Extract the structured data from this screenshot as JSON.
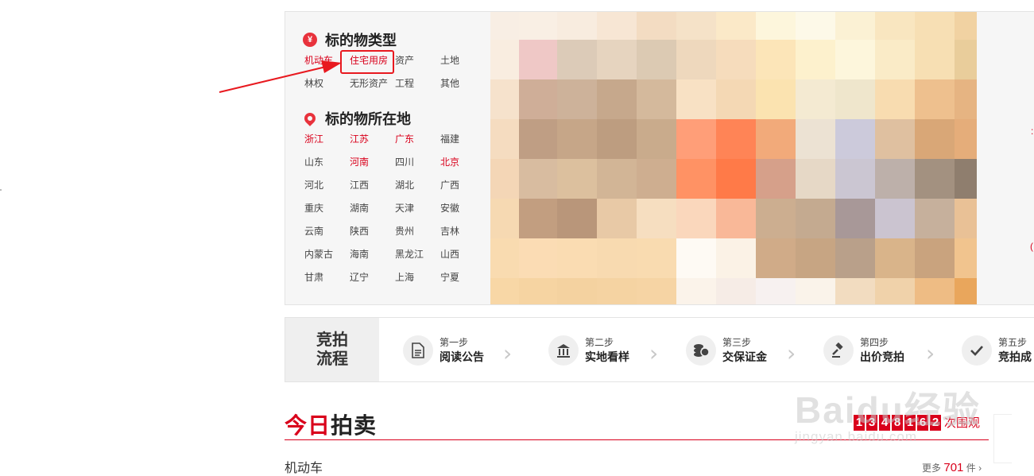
{
  "categories": {
    "section1_icon": "¥",
    "section1_title": "标的物类型",
    "types": [
      {
        "label": "机动车",
        "red": true
      },
      {
        "label": "住宅用房",
        "red": true
      },
      {
        "label": "资产",
        "red": false
      },
      {
        "label": "土地",
        "red": false
      },
      {
        "label": "林权",
        "red": false
      },
      {
        "label": "无形资产",
        "red": false
      },
      {
        "label": "工程",
        "red": false
      },
      {
        "label": "其他",
        "red": false
      }
    ],
    "section2_title": "标的物所在地",
    "regions": [
      {
        "label": "浙江",
        "red": true
      },
      {
        "label": "江苏",
        "red": true
      },
      {
        "label": "广东",
        "red": true
      },
      {
        "label": "福建",
        "red": false
      },
      {
        "label": "山东",
        "red": false
      },
      {
        "label": "河南",
        "red": true
      },
      {
        "label": "四川",
        "red": false
      },
      {
        "label": "北京",
        "red": true
      },
      {
        "label": "河北",
        "red": false
      },
      {
        "label": "江西",
        "red": false
      },
      {
        "label": "湖北",
        "red": false
      },
      {
        "label": "广西",
        "red": false
      },
      {
        "label": "重庆",
        "red": false
      },
      {
        "label": "湖南",
        "red": false
      },
      {
        "label": "天津",
        "red": false
      },
      {
        "label": "安徽",
        "red": false
      },
      {
        "label": "云南",
        "red": false
      },
      {
        "label": "陕西",
        "red": false
      },
      {
        "label": "贵州",
        "red": false
      },
      {
        "label": "吉林",
        "red": false
      },
      {
        "label": "内蒙古",
        "red": false
      },
      {
        "label": "海南",
        "red": false
      },
      {
        "label": "黑龙江",
        "red": false
      },
      {
        "label": "山西",
        "red": false
      },
      {
        "label": "甘肃",
        "red": false
      },
      {
        "label": "辽宁",
        "red": false
      },
      {
        "label": "上海",
        "red": false
      },
      {
        "label": "宁夏",
        "red": false
      }
    ]
  },
  "process": {
    "title_line1": "竞拍",
    "title_line2": "流程",
    "steps": [
      {
        "step": "第一步",
        "name": "阅读公告",
        "icon": "document-icon"
      },
      {
        "step": "第二步",
        "name": "实地看样",
        "icon": "bank-icon"
      },
      {
        "step": "第三步",
        "name": "交保证金",
        "icon": "coins-icon"
      },
      {
        "step": "第四步",
        "name": "出价竞拍",
        "icon": "gavel-icon"
      },
      {
        "step": "第五步",
        "name": "竞拍成",
        "icon": "check-icon"
      }
    ]
  },
  "today": {
    "title_red": "今日",
    "title_black": "拍卖",
    "counter_digits": [
      "1",
      "3",
      "4",
      "8",
      "1",
      "6",
      "2"
    ],
    "counter_label": "次围观",
    "first_category": "机动车",
    "more_label": "更多",
    "more_count": "701",
    "more_unit": "件 ›"
  },
  "watermark": {
    "main": "Baidu经验",
    "sub": "jingyan.baidu.com"
  },
  "colors": {
    "accent": "#d9001b",
    "highlight_box": "#e8191f"
  }
}
